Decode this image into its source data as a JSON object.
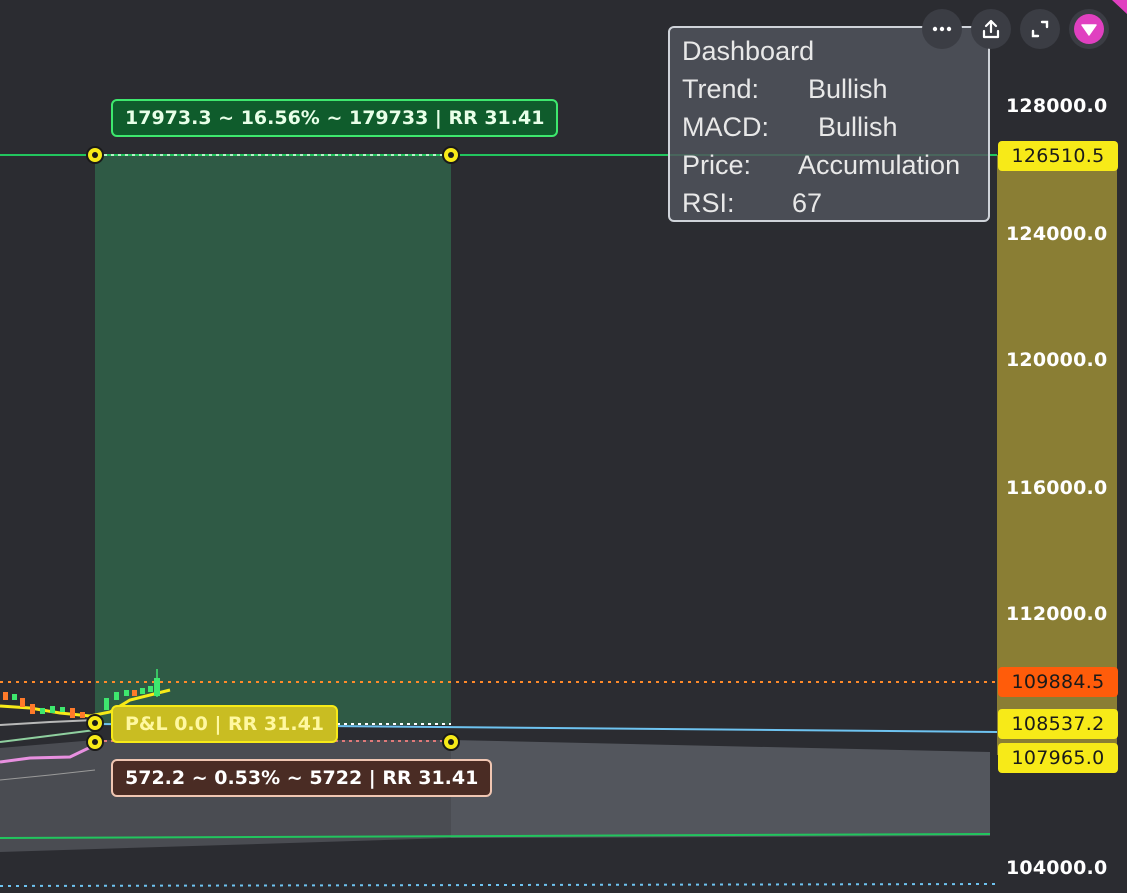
{
  "toolbar": {
    "more_icon": "ellipsis-icon",
    "share_icon": "upload-icon",
    "fullscreen_icon": "expand-icon",
    "collapse_icon": "triangle-down-icon"
  },
  "dashboard": {
    "title": "Dashboard",
    "rows": [
      {
        "key": "Trend:",
        "value": "Bullish"
      },
      {
        "key": "MACD:",
        "value": "Bullish"
      },
      {
        "key": "Price:",
        "value": "Accumulation"
      },
      {
        "key": "RSI:",
        "value": "67"
      }
    ]
  },
  "position": {
    "target_label": "17973.3 ~ 16.56% ~ 179733 | RR 31.41",
    "pnl_label": "P&L 0.0 | RR 31.41",
    "stop_label": "572.2 ~ 0.53% ~ 5722 | RR 31.41"
  },
  "price_axis": {
    "ticks": [
      "128000.0",
      "124000.0",
      "120000.0",
      "116000.0",
      "112000.0",
      "104000.0"
    ],
    "tags": {
      "target": "126510.5",
      "current": "109884.5",
      "entry": "108537.2",
      "stop": "107965.0"
    }
  },
  "colors": {
    "background": "#2b2c31",
    "profit_zone": "#2f5a45",
    "target_line": "#22c55e",
    "current_line": "#ff8a2a",
    "entry_line": "#6ec3f0",
    "handle": "#f7ea18",
    "axis_band": "#8a7e34"
  }
}
